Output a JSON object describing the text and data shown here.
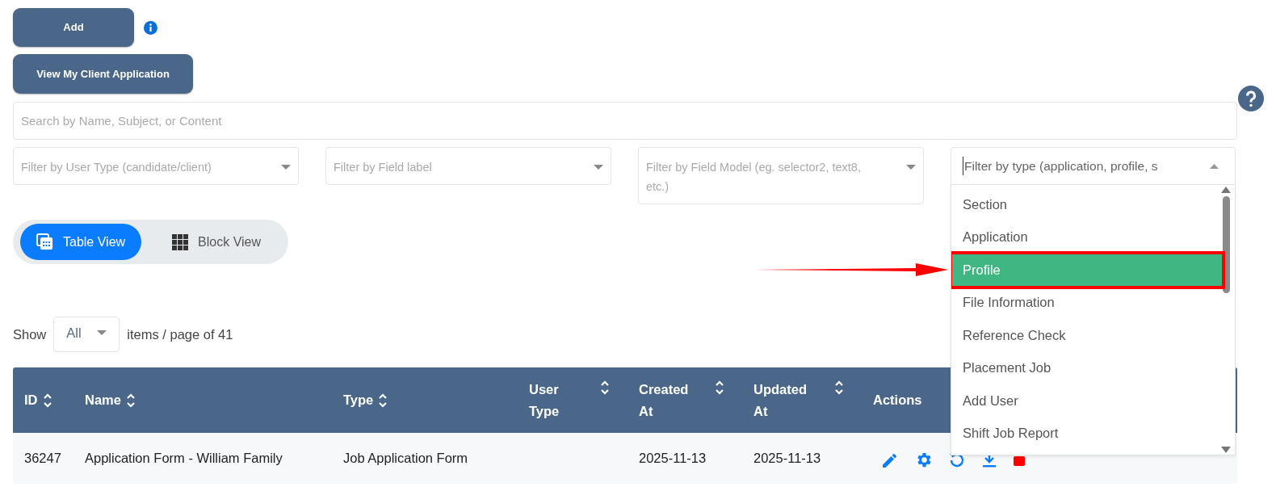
{
  "buttons": [
    {
      "label": "Add",
      "info": true
    },
    {
      "label": "View My Client Application",
      "info": false
    }
  ],
  "search": {
    "placeholder": "Search by Name, Subject, or Content"
  },
  "filters": [
    {
      "placeholder": "Filter by User Type (candidate/client)",
      "open": false
    },
    {
      "placeholder": "Filter by Field label",
      "open": false
    },
    {
      "placeholder": "Filter by Field Model (eg. selector2, text8, etc.)",
      "open": false
    },
    {
      "placeholder": "Filter by type (application, profile, s",
      "open": true,
      "options": [
        {
          "label": "Section",
          "selected": false,
          "highlighted": false
        },
        {
          "label": "Application",
          "selected": false,
          "highlighted": false
        },
        {
          "label": "Profile",
          "selected": true,
          "highlighted": true
        },
        {
          "label": "File Information",
          "selected": false,
          "highlighted": false
        },
        {
          "label": "Reference Check",
          "selected": false,
          "highlighted": false
        },
        {
          "label": "Placement Job",
          "selected": false,
          "highlighted": false
        },
        {
          "label": "Add User",
          "selected": false,
          "highlighted": false
        },
        {
          "label": "Shift Job Report",
          "selected": false,
          "highlighted": false
        }
      ]
    }
  ],
  "view_toggle": [
    {
      "label": "Table View",
      "kind": "table",
      "selected": true
    },
    {
      "label": "Block View",
      "kind": "block",
      "selected": false
    }
  ],
  "pagination": {
    "show_label": "Show",
    "page_size": "All",
    "suffix": "items / page of 41"
  },
  "table": {
    "columns": [
      {
        "label": "ID",
        "sortable": true
      },
      {
        "label": "Name",
        "sortable": true
      },
      {
        "label": "Type",
        "sortable": true
      },
      {
        "label": "User Type",
        "sortable": true
      },
      {
        "label": "Created At",
        "sortable": true
      },
      {
        "label": "Updated At",
        "sortable": true
      },
      {
        "label": "Actions",
        "sortable": false
      }
    ],
    "rows": [
      {
        "cells": [
          "36247",
          "Application Form - William Family",
          "Job Application Form",
          "",
          "2025-11-13",
          "2025-11-13"
        ],
        "actions": [
          {
            "kind": "edit"
          },
          {
            "kind": "settings"
          },
          {
            "kind": "refresh"
          },
          {
            "kind": "download"
          },
          {
            "kind": "delete"
          }
        ]
      }
    ]
  }
}
